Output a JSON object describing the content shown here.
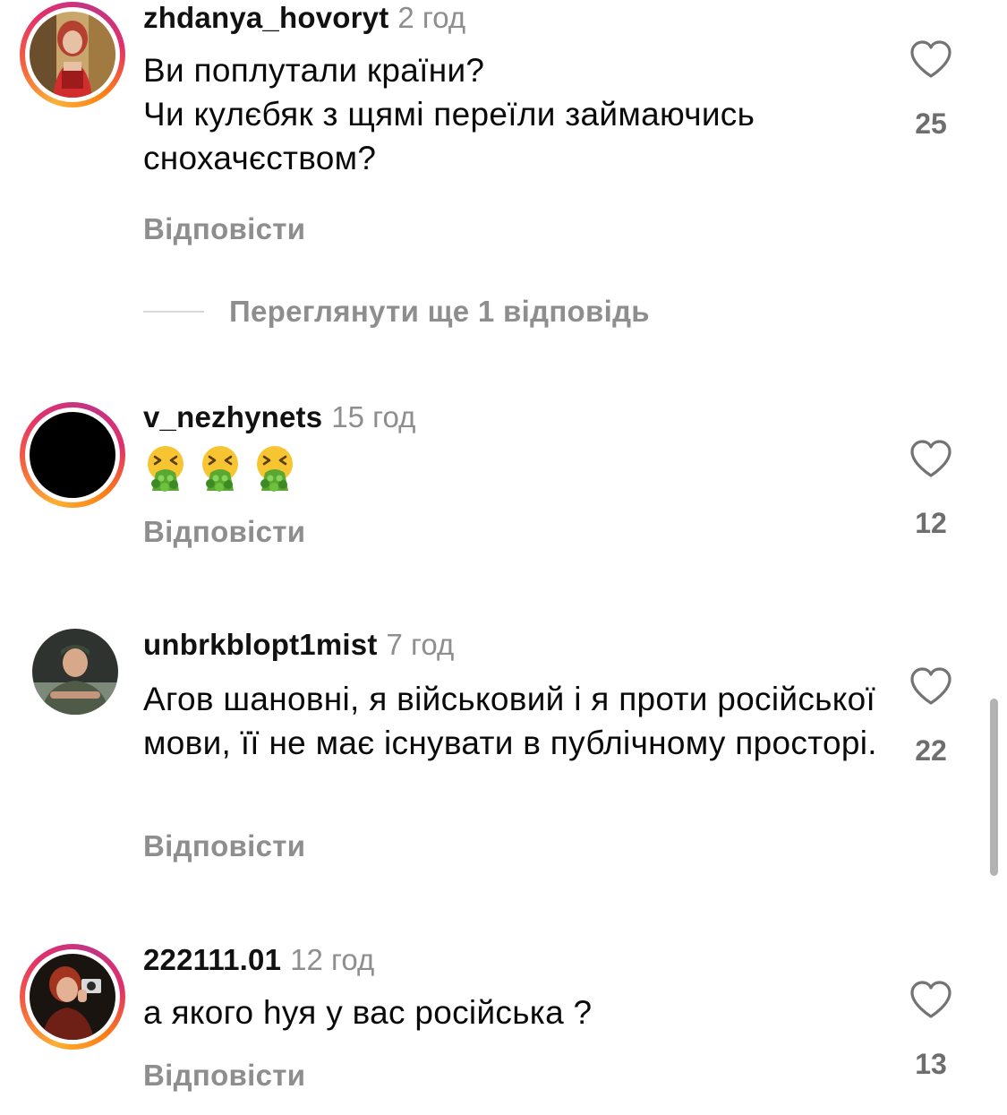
{
  "colors": {
    "username": "#111111",
    "secondary_text": "#8e8e8e",
    "body_text": "#0a0a0a",
    "like_count": "#6e6e6e",
    "story_ring": [
      "#fbb034",
      "#f56040",
      "#e1306c",
      "#c13584"
    ]
  },
  "comments": [
    {
      "username": "zhdanya_hovoryt",
      "time": "2 год",
      "text": "Ви поплутали країни?\nЧи кулєбяк з щямі переїли займаючись снохачєством?",
      "reply_label": "Відповісти",
      "likes": "25",
      "has_story_ring": true,
      "icon": "heart-outline-icon"
    },
    {
      "username": "v_nezhynets",
      "time": "15 год",
      "emoji_names": [
        "face-vomiting-emoji",
        "face-vomiting-emoji",
        "face-vomiting-emoji"
      ],
      "reply_label": "Відповісти",
      "likes": "12",
      "has_story_ring": true,
      "icon": "heart-outline-icon"
    },
    {
      "username": "unbrkblopt1mist",
      "time": "7 год",
      "text": "Агов шановні, я військовий і я проти російської мови, її не має існувати в публічному просторі.",
      "reply_label": "Відповісти",
      "likes": "22",
      "has_story_ring": false,
      "icon": "heart-outline-icon"
    },
    {
      "username": "222111.01",
      "time": "12 год",
      "text": "а якого һуя у вас російська ?",
      "reply_label": "Відповісти",
      "likes": "13",
      "has_story_ring": true,
      "icon": "heart-outline-icon"
    }
  ],
  "view_more_replies": "Переглянути ще 1 відповідь"
}
